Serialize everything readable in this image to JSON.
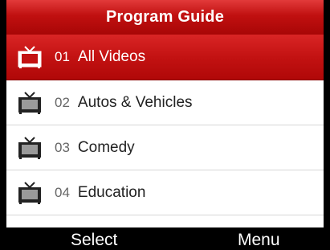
{
  "header": {
    "title": "Program Guide"
  },
  "items": [
    {
      "number": "01",
      "label": "All Videos",
      "selected": true
    },
    {
      "number": "02",
      "label": "Autos & Vehicles",
      "selected": false
    },
    {
      "number": "03",
      "label": "Comedy",
      "selected": false
    },
    {
      "number": "04",
      "label": "Education",
      "selected": false
    }
  ],
  "softkeys": {
    "left": "Select",
    "right": "Menu"
  },
  "colors": {
    "accent": "#c01010",
    "list_bg": "#ffffff",
    "bar_bg": "#000000"
  },
  "icon": "tv-icon"
}
